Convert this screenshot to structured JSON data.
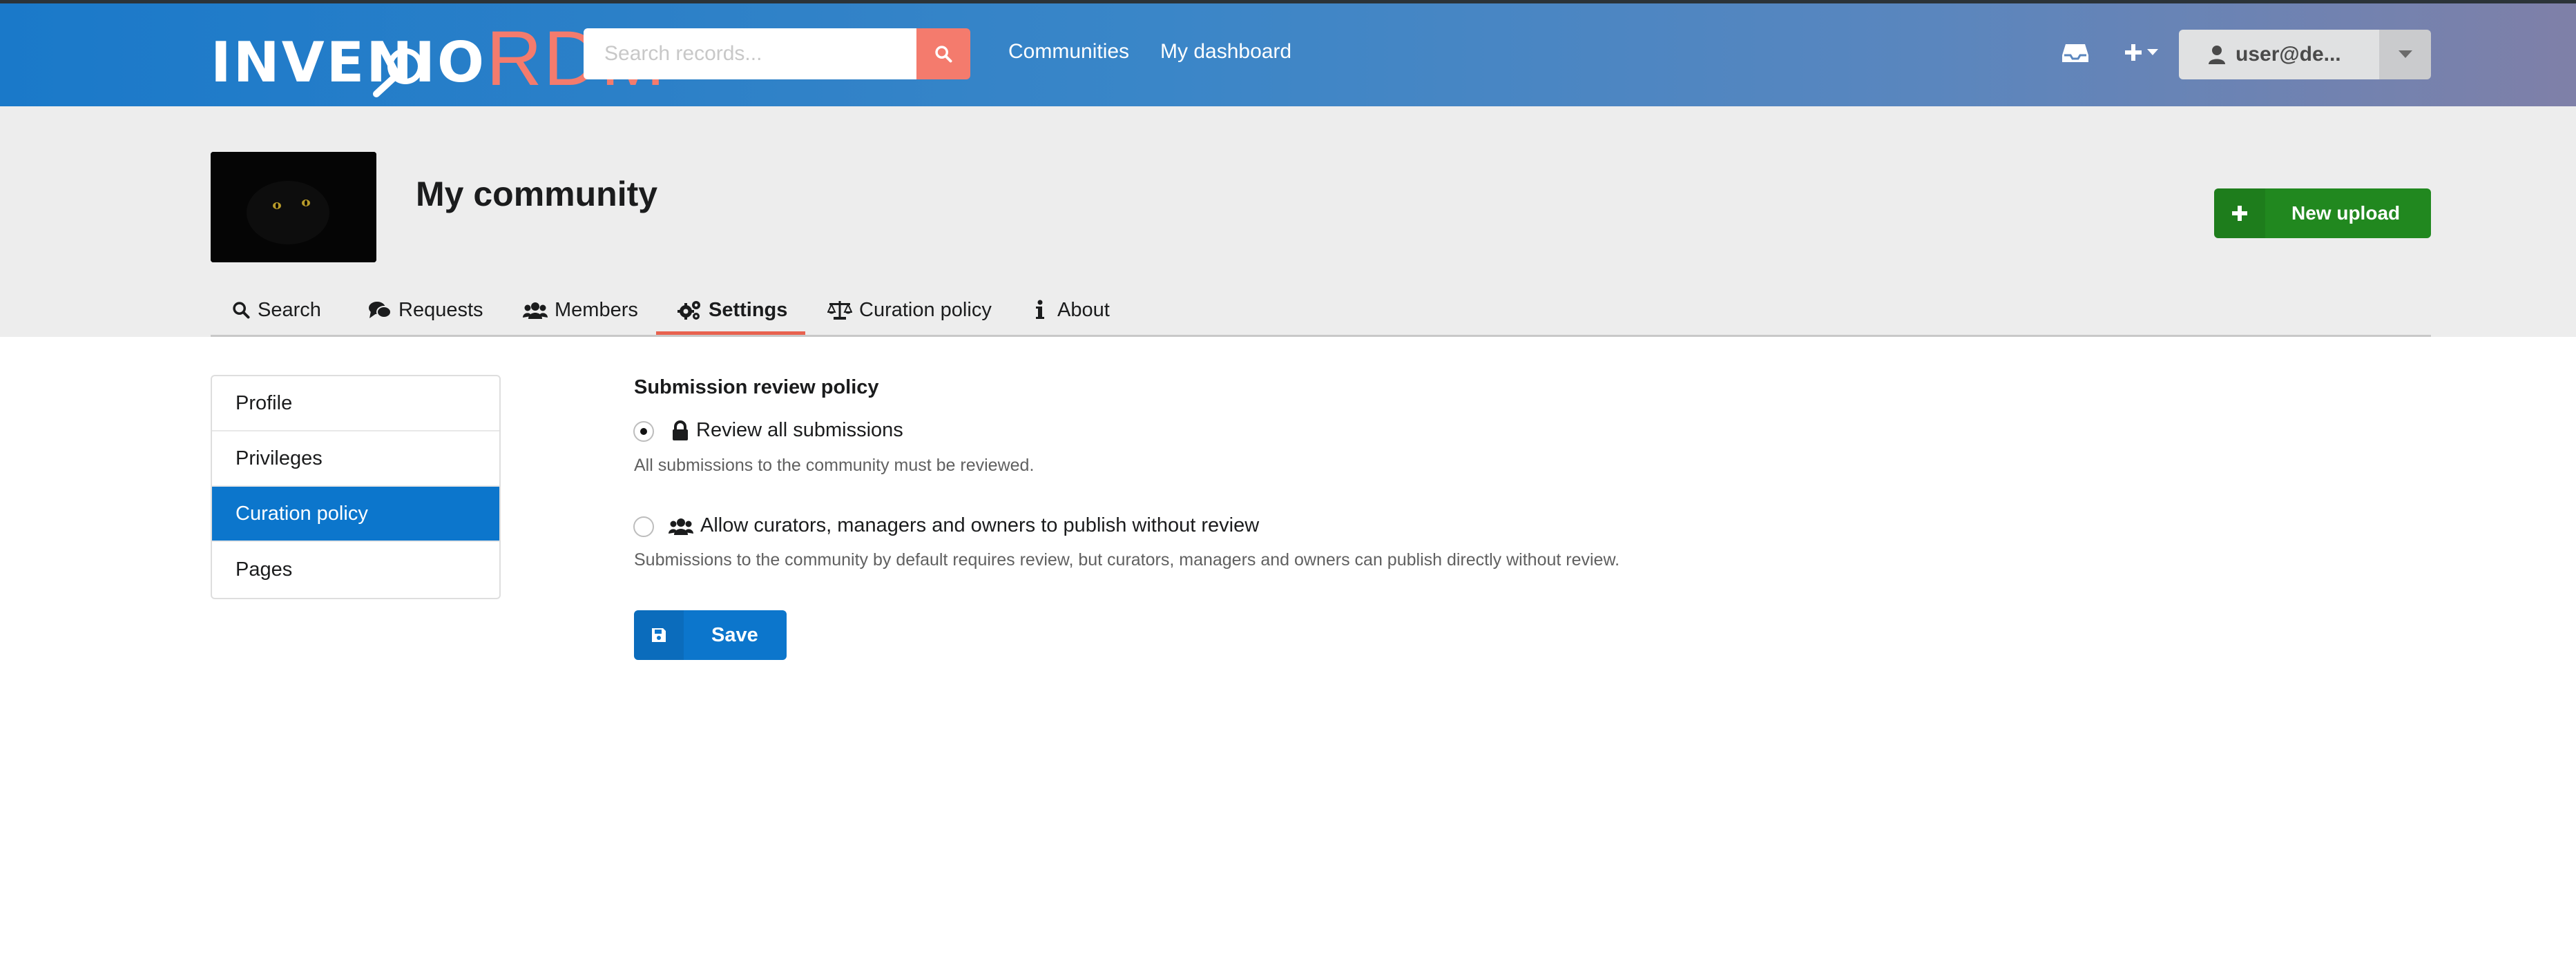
{
  "header": {
    "logo_text_1": "INVENIO",
    "logo_text_2": "RDM",
    "search_placeholder": "Search records...",
    "nav": [
      "Communities",
      "My dashboard"
    ],
    "user_label": "user@de..."
  },
  "community": {
    "title": "My community",
    "new_upload_label": "New upload"
  },
  "tabs": [
    {
      "label": "Search",
      "icon": "search-icon"
    },
    {
      "label": "Requests",
      "icon": "comments-icon"
    },
    {
      "label": "Members",
      "icon": "users-icon"
    },
    {
      "label": "Settings",
      "icon": "cogs-icon",
      "active": true
    },
    {
      "label": "Curation policy",
      "icon": "balance-scale-icon"
    },
    {
      "label": "About",
      "icon": "info-icon"
    }
  ],
  "side_menu": [
    {
      "label": "Profile"
    },
    {
      "label": "Privileges"
    },
    {
      "label": "Curation policy",
      "active": true
    },
    {
      "label": "Pages"
    }
  ],
  "policy": {
    "section_title": "Submission review policy",
    "options": [
      {
        "label": "Review all submissions",
        "icon": "lock-icon",
        "description": "All submissions to the community must be reviewed.",
        "checked": true
      },
      {
        "label": "Allow curators, managers and owners to publish without review",
        "icon": "users-icon",
        "description": "Submissions to the community by default requires review, but curators, managers and owners can publish directly without review.",
        "checked": false
      }
    ],
    "save_label": "Save"
  },
  "colors": {
    "header_gradient_start": "#1a79c9",
    "header_gradient_end": "#7f80a8",
    "accent_rdm": "#f47b6d",
    "primary_blue": "#0c76cc",
    "success_green": "#21881f",
    "active_tab_underline": "#e8624f"
  }
}
